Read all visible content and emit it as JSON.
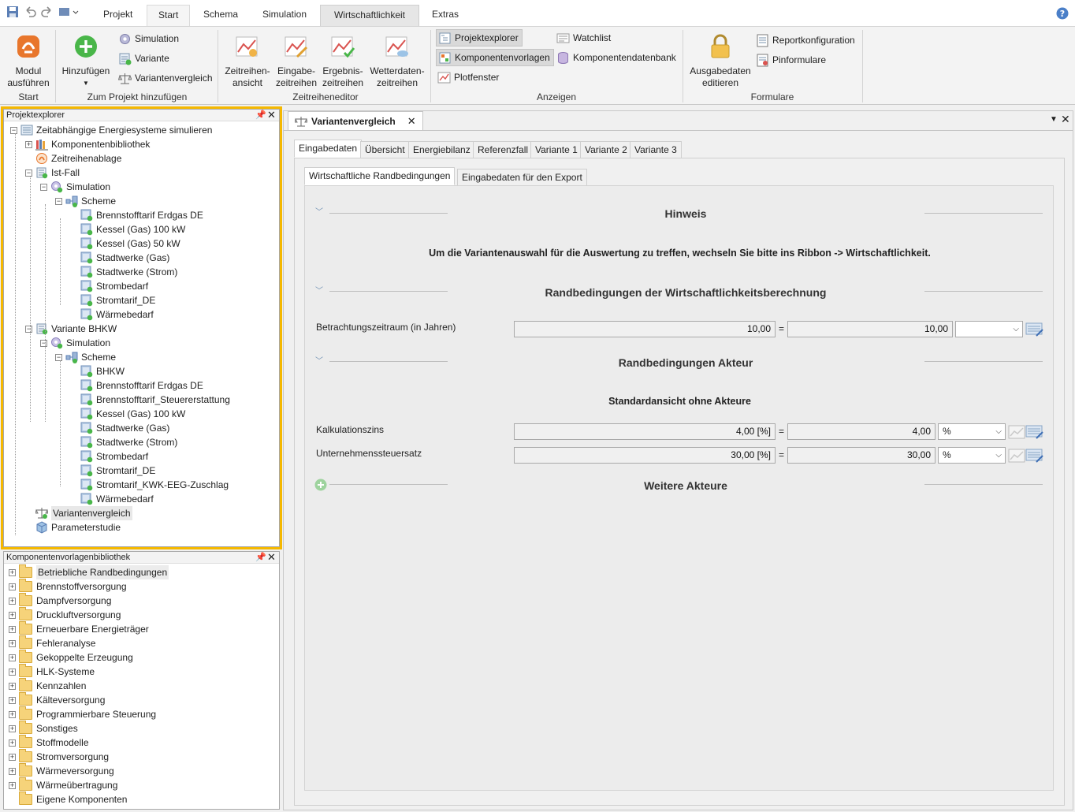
{
  "ribbon_tabs": [
    "Projekt",
    "Start",
    "Schema",
    "Simulation",
    "Wirtschaftlichkeit",
    "Extras"
  ],
  "ribbon": {
    "modul_ausfuehren": "Modul\nausführen",
    "hinzufuegen": "Hinzufügen",
    "simulation": "Simulation",
    "variante": "Variante",
    "variantenvergleich": "Variantenvergleich",
    "zeitreihen_ansicht": "Zeitreihen-\nansicht",
    "eingabe_zeitreihen": "Eingabe-\nzeitreihen",
    "ergebnis_zeitreihen": "Ergebnis-\nzeitreihen",
    "wetterdaten_zeitreihen": "Wetterdaten-\nzeitreihen",
    "projektexplorer": "Projektexplorer",
    "komponentenvorlagen": "Komponentenvorlagen",
    "plotfenster": "Plotfenster",
    "watchlist": "Watchlist",
    "komponentendatenbank": "Komponentendatenbank",
    "ausgabedaten_editieren": "Ausgabedaten\neditieren",
    "reportkonfiguration": "Reportkonfiguration",
    "pinformulare": "Pinformulare",
    "groups": {
      "start": "Start",
      "zum_projekt": "Zum Projekt hinzufügen",
      "zeitreiheneditor": "Zeitreiheneditor",
      "anzeigen": "Anzeigen",
      "formulare": "Formulare"
    }
  },
  "project_explorer": {
    "title": "Projektexplorer",
    "root": "Zeitabhängige Energiesysteme simulieren",
    "komponentenbibliothek": "Komponentenbibliothek",
    "zeitreihenablage": "Zeitreihenablage",
    "ist_fall": "Ist-Fall",
    "simulation": "Simulation",
    "scheme": "Scheme",
    "ist_fall_items": [
      "Brennstofftarif Erdgas DE",
      "Kessel (Gas) 100 kW",
      "Kessel (Gas) 50 kW",
      "Stadtwerke (Gas)",
      "Stadtwerke (Strom)",
      "Strombedarf",
      "Stromtarif_DE",
      "Wärmebedarf"
    ],
    "variante_bhkw": "Variante BHKW",
    "bhkw_items": [
      "BHKW",
      "Brennstofftarif Erdgas DE",
      "Brennstofftarif_Steuererstattung",
      "Kessel (Gas) 100 kW",
      "Stadtwerke (Gas)",
      "Stadtwerke (Strom)",
      "Strombedarf",
      "Stromtarif_DE",
      "Stromtarif_KWK-EEG-Zuschlag",
      "Wärmebedarf"
    ],
    "variantenvergleich": "Variantenvergleich",
    "parameterstudie": "Parameterstudie"
  },
  "library": {
    "title": "Komponentenvorlagenbibliothek",
    "folders": [
      "Betriebliche Randbedingungen",
      "Brennstoffversorgung",
      "Dampfversorgung",
      "Druckluftversorgung",
      "Erneuerbare Energieträger",
      "Fehleranalyse",
      "Gekoppelte Erzeugung",
      "HLK-Systeme",
      "Kennzahlen",
      "Kälteversorgung",
      "Programmierbare Steuerung",
      "Sonstiges",
      "Stoffmodelle",
      "Stromversorgung",
      "Wärmeversorgung",
      "Wärmeübertragung",
      "Eigene Komponenten"
    ]
  },
  "document": {
    "tab_title": "Variantenvergleich",
    "tabs": [
      "Eingabedaten",
      "Übersicht",
      "Energiebilanz",
      "Referenzfall",
      "Variante 1",
      "Variante 2",
      "Variante 3"
    ],
    "subtabs": [
      "Wirtschaftliche Randbedingungen",
      "Eingabedaten für den Export"
    ],
    "hinweis_title": "Hinweis",
    "hinweis_text": "Um die Variantenauswahl für die Auswertung zu treffen, wechseln Sie bitte ins Ribbon -> Wirtschaftlichkeit.",
    "rb_title": "Randbedingungen der Wirtschaftlichkeitsberechnung",
    "betrachtung_label": "Betrachtungszeitraum (in Jahren)",
    "betrachtung_value": "10,00",
    "betrachtung_result": "10,00",
    "akteur_title": "Randbedingungen Akteur",
    "standard_title": "Standardansicht ohne Akteure",
    "zins_label": "Kalkulationszins",
    "zins_value": "4,00 [%]",
    "zins_result": "4,00",
    "zins_unit": "%",
    "steuer_label": "Unternehmenssteuersatz",
    "steuer_value": "30,00 [%]",
    "steuer_result": "30,00",
    "steuer_unit": "%",
    "weitere_title": "Weitere Akteure",
    "equals": "="
  },
  "colors": {
    "highlight_border": "#f5b800",
    "accent_orange": "#e8762c",
    "green": "#49b649"
  }
}
